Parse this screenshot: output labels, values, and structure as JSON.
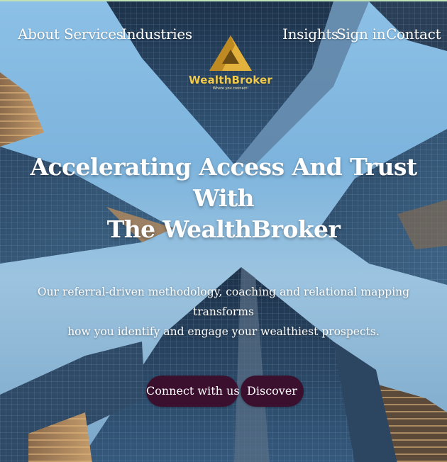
{
  "nav": {
    "left": [
      {
        "label": "About"
      },
      {
        "label": "Services"
      },
      {
        "label": "Industries"
      }
    ],
    "right": [
      {
        "label": "Insights"
      },
      {
        "label": "Sign in"
      },
      {
        "label": "Contact"
      }
    ]
  },
  "logo": {
    "name": "WealthBroker",
    "tagline": "Where you connect!",
    "icon": "triangle-logo-icon",
    "color": "#f1c94b"
  },
  "hero": {
    "headline_line1": "Accelerating Access And Trust With",
    "headline_line2": "The WealthBroker",
    "subtext_line1": "Our referral-driven methodology, coaching and relational mapping transforms",
    "subtext_line2": "how you identify and engage your wealthiest prospects.",
    "background": "skyscrapers-photo"
  },
  "buttons": {
    "connect_label": "Connect with us",
    "discover_label": "Discover",
    "color": "#3b0f2e"
  }
}
